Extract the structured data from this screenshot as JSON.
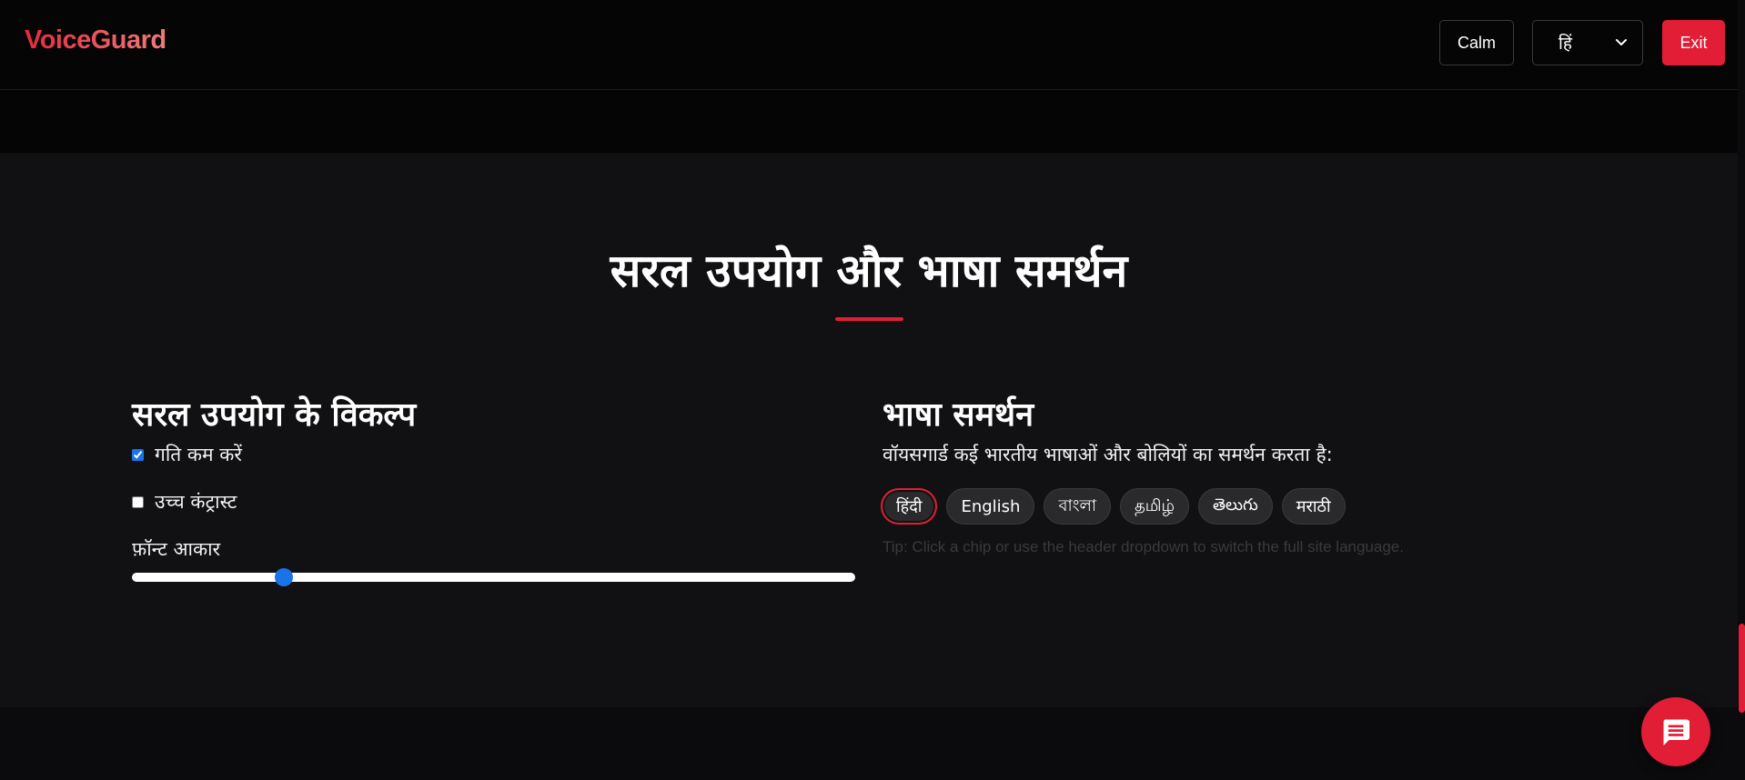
{
  "header": {
    "brand": "VoiceGuard",
    "calm_label": "Calm",
    "language_selected": "हिं",
    "exit_label": "Exit"
  },
  "section": {
    "title": "सरल उपयोग और भाषा समर्थन",
    "accessibility": {
      "heading": "सरल उपयोग के विकल्प",
      "options": [
        {
          "label": "गति कम करें",
          "checked": true
        },
        {
          "label": "उच्च कंट्रास्ट",
          "checked": false
        }
      ],
      "font_size_label": "फ़ॉन्ट आकार",
      "font_size_fraction": 0.21
    },
    "language": {
      "heading": "भाषा समर्थन",
      "description": "वॉयसगार्ड कई भारतीय भाषाओं और बोलियों का समर्थन करता है:",
      "chips": [
        "हिंदी",
        "English",
        "বাংলা",
        "தமிழ்",
        "తెలుగు",
        "मराठी"
      ],
      "active_chip": "हिंदी",
      "tip": "Tip: Click a chip or use the header dropdown to switch the full site language."
    }
  },
  "colors": {
    "accent": "#e21d36",
    "background": "#111113",
    "header_bg": "#050505",
    "slider_thumb": "#1a73e8"
  },
  "icons": {
    "chat": "chat-bubble-icon",
    "select": "chevron-down-icon"
  }
}
